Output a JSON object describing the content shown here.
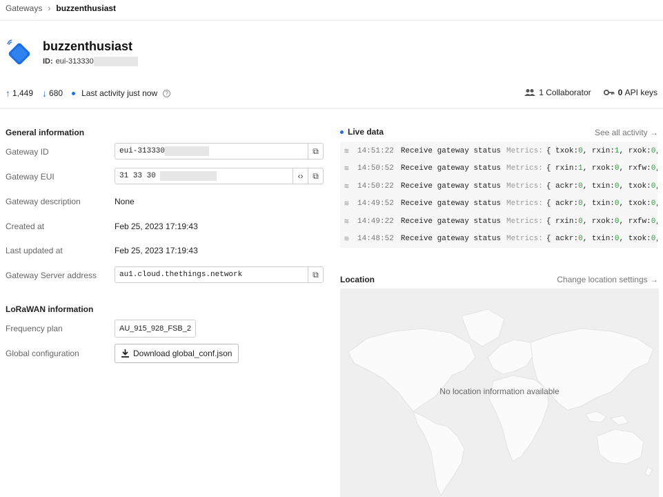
{
  "breadcrumb": {
    "parent": "Gateways",
    "separator": "›",
    "current": "buzzenthusiast"
  },
  "header": {
    "title": "buzzenthusiast",
    "id_label": "ID:",
    "id_value": "eui-313330"
  },
  "stats": {
    "uplink": "1,449",
    "downlink": "680",
    "activity": "Last activity just now",
    "collaborators": "1 Collaborator",
    "api_keys_count": "0",
    "api_keys_label": "API keys"
  },
  "general": {
    "title": "General information",
    "gateway_id_label": "Gateway ID",
    "gateway_id_value": "eui-313330",
    "gateway_eui_label": "Gateway EUI",
    "gateway_eui_value": "31 33 30",
    "description_label": "Gateway description",
    "description_value": "None",
    "created_label": "Created at",
    "created_value": "Feb 25, 2023 17:19:43",
    "updated_label": "Last updated at",
    "updated_value": "Feb 25, 2023 17:19:43",
    "server_label": "Gateway Server address",
    "server_value": "au1.cloud.thethings.network"
  },
  "lorawan": {
    "title": "LoRaWAN information",
    "freq_label": "Frequency plan",
    "freq_value": "AU_915_928_FSB_2",
    "global_label": "Global configuration",
    "download_label": "Download global_conf.json"
  },
  "live": {
    "title": "Live data",
    "see_all": "See all activity →",
    "rows": [
      {
        "time": "14:51:22",
        "event": "Receive gateway status",
        "metrics": "Metrics:",
        "k1": "{ txok: ",
        "v1": "0",
        "k2": ", rxin: ",
        "v2": "1",
        "k3": ", rxok: ",
        "v3": "0",
        "tail": ","
      },
      {
        "time": "14:50:52",
        "event": "Receive gateway status",
        "metrics": "Metrics:",
        "k1": "{ rxin: ",
        "v1": "1",
        "k2": ", rxok: ",
        "v2": "0",
        "k3": ", rxfw: ",
        "v3": "0",
        "tail": ","
      },
      {
        "time": "14:50:22",
        "event": "Receive gateway status",
        "metrics": "Metrics:",
        "k1": "{ ackr: ",
        "v1": "0",
        "k2": ", txin: ",
        "v2": "0",
        "k3": ", txok: ",
        "v3": "0",
        "tail": ","
      },
      {
        "time": "14:49:52",
        "event": "Receive gateway status",
        "metrics": "Metrics:",
        "k1": "{ ackr: ",
        "v1": "0",
        "k2": ", txin: ",
        "v2": "0",
        "k3": ", txok: ",
        "v3": "0",
        "tail": ","
      },
      {
        "time": "14:49:22",
        "event": "Receive gateway status",
        "metrics": "Metrics:",
        "k1": "{ rxin: ",
        "v1": "0",
        "k2": ", rxok: ",
        "v2": "0",
        "k3": ", rxfw: ",
        "v3": "0",
        "tail": ","
      },
      {
        "time": "14:48:52",
        "event": "Receive gateway status",
        "metrics": "Metrics:",
        "k1": "{ ackr: ",
        "v1": "0",
        "k2": ", txin: ",
        "v2": "0",
        "k3": ", txok: ",
        "v3": "0",
        "tail": ","
      }
    ]
  },
  "location": {
    "title": "Location",
    "change": "Change location settings →",
    "empty": "No location information available"
  },
  "colors": {
    "accent": "#1f6fde",
    "metric_value": "#2a9a3b"
  }
}
